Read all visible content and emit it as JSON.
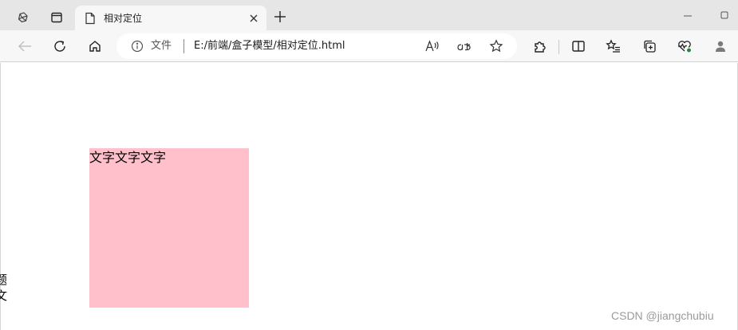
{
  "browser": {
    "tab": {
      "title": "相对定位"
    },
    "address": {
      "info_label": "文件",
      "url": "E:/前端/盒子模型/相对定位.html"
    },
    "icons": {
      "tab_actions": "workspaces-icon",
      "vertical_tabs": "tab-panel-icon",
      "page": "page-icon",
      "close": "close-icon",
      "new_tab": "plus-icon",
      "minimize": "minimize-icon",
      "maximize": "maximize-icon",
      "back": "back-arrow-icon",
      "refresh": "refresh-icon",
      "home": "home-icon",
      "info": "info-icon",
      "read_aloud": "read-aloud-icon",
      "translate": "translate-icon",
      "favorite": "star-icon",
      "extensions": "puzzle-icon",
      "split_screen": "split-screen-icon",
      "favorites": "favorites-list-icon",
      "collections": "collections-icon",
      "browser_essentials": "heartbeat-icon",
      "profile": "profile-icon"
    }
  },
  "page": {
    "box_text": "文字文字文字",
    "box_color": "#ffc0cb",
    "clipped_glyphs": [
      "题",
      "文"
    ]
  },
  "watermark": {
    "text": "CSDN @jiangchubiu"
  }
}
